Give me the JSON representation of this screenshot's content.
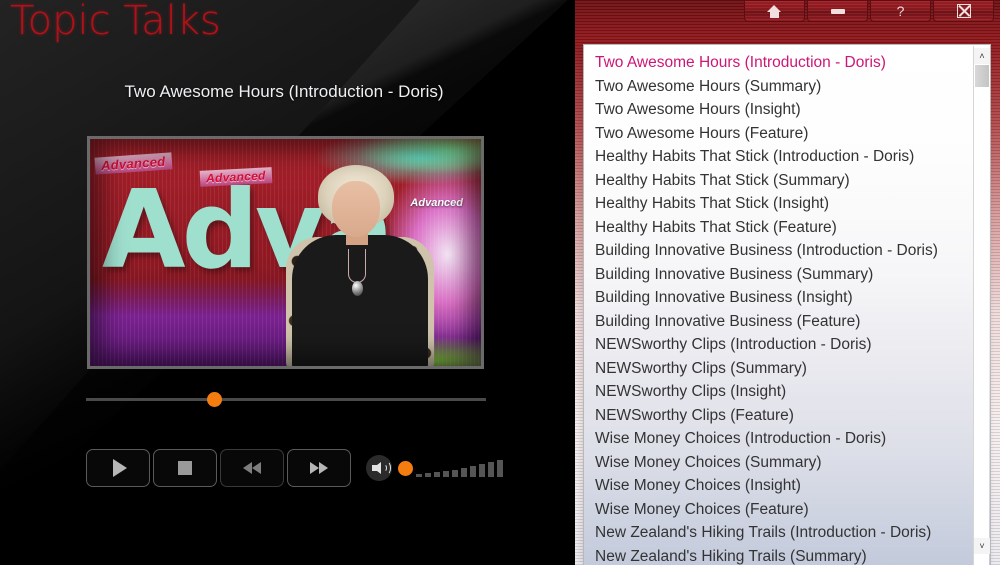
{
  "app": {
    "title": "Topic Talks",
    "accent_red": "#b01219",
    "accent_orange": "#f57c0e",
    "selected_magenta": "#cc1677"
  },
  "titlebar": {
    "buttons": [
      {
        "name": "home",
        "icon": "home-icon",
        "label": ""
      },
      {
        "name": "minimize",
        "icon": "minimize-icon",
        "label": ""
      },
      {
        "name": "help",
        "icon": "question-mark-icon",
        "label": "?"
      },
      {
        "name": "close",
        "icon": "close-box-icon",
        "label": ""
      }
    ]
  },
  "player": {
    "now_playing_title": "Two Awesome Hours (Introduction - Doris)",
    "video": {
      "banner_text_1": "Advanced",
      "banner_text_2": "Advanced",
      "big_text": "Adva",
      "small_logo_text": "Advanced"
    },
    "progress": {
      "value_percent": 32
    },
    "controls": [
      {
        "name": "play",
        "icon": "play-icon",
        "enabled": true
      },
      {
        "name": "stop",
        "icon": "stop-icon",
        "enabled": true
      },
      {
        "name": "rewind",
        "icon": "rewind-icon",
        "enabled": false
      },
      {
        "name": "fast-forward",
        "icon": "fast-forward-icon",
        "enabled": true
      }
    ],
    "volume": {
      "icon": "speaker-icon",
      "value_percent": 5,
      "steps": 10
    }
  },
  "playlist": {
    "selected_index": 0,
    "scrollbar": {
      "up_arrow": "˄",
      "down_arrow": "˅"
    },
    "items": [
      "Two Awesome Hours (Introduction - Doris)",
      "Two Awesome Hours (Summary)",
      "Two Awesome Hours (Insight)",
      "Two Awesome Hours (Feature)",
      "Healthy Habits That Stick (Introduction - Doris)",
      "Healthy Habits That Stick (Summary)",
      "Healthy Habits That Stick (Insight)",
      "Healthy Habits That Stick (Feature)",
      "Building Innovative Business (Introduction - Doris)",
      "Building Innovative Business (Summary)",
      "Building Innovative Business (Insight)",
      "Building Innovative Business (Feature)",
      "NEWSworthy Clips (Introduction - Doris)",
      "NEWSworthy Clips (Summary)",
      "NEWSworthy Clips (Insight)",
      "NEWSworthy Clips (Feature)",
      "Wise Money Choices (Introduction - Doris)",
      "Wise Money Choices (Summary)",
      "Wise Money Choices (Insight)",
      "Wise Money Choices (Feature)",
      "New Zealand's Hiking Trails (Introduction - Doris)",
      "New Zealand's Hiking Trails (Summary)"
    ]
  }
}
